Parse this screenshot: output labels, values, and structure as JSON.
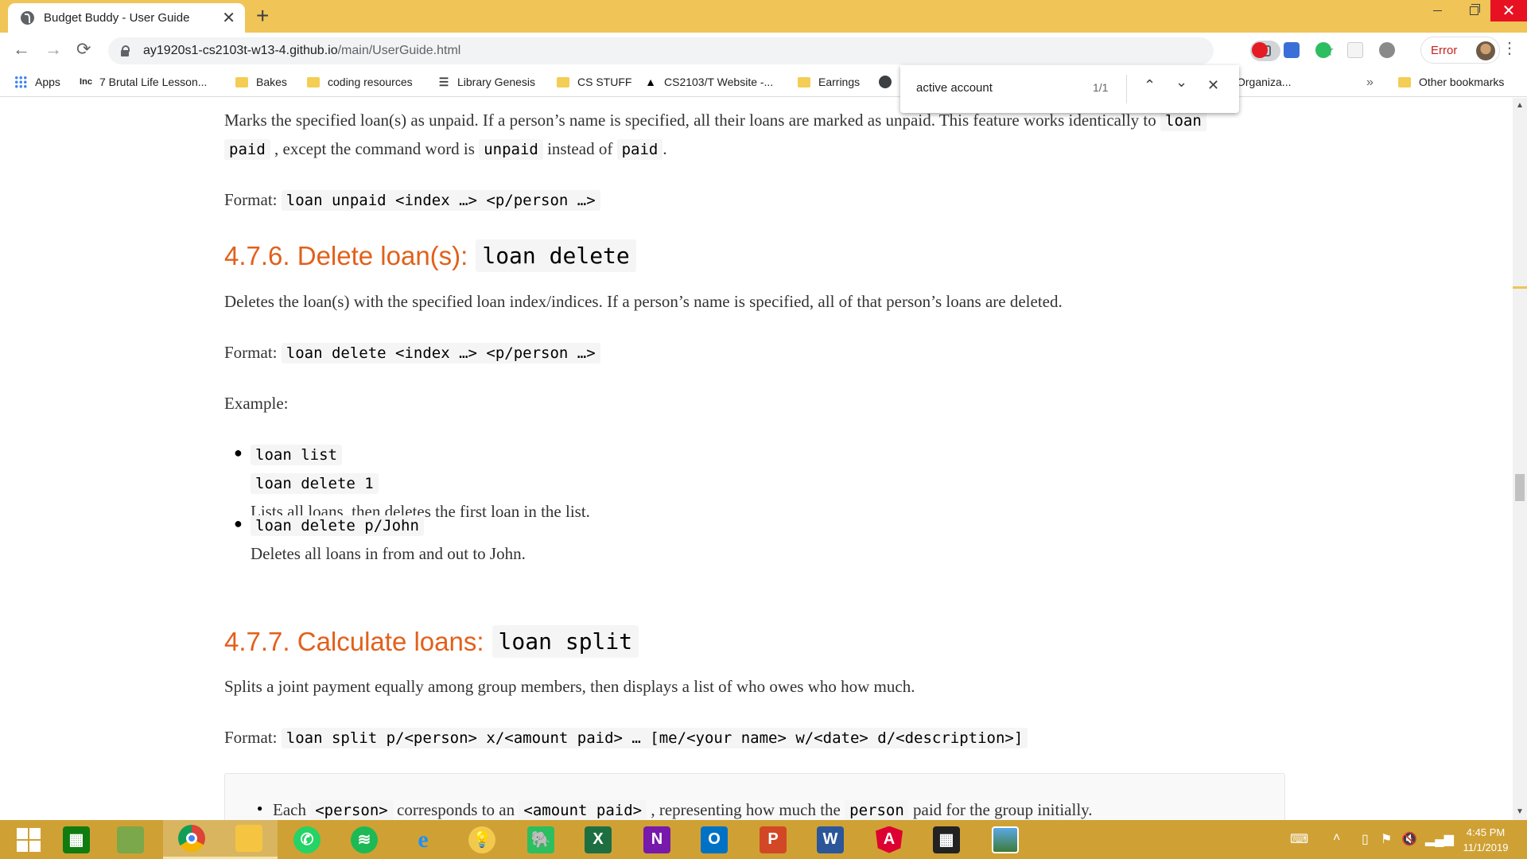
{
  "tab": {
    "title": "Budget Buddy - User Guide",
    "close": "✕",
    "new_tab": "+"
  },
  "window": {
    "minimize": "",
    "maximize": "",
    "close": "✕"
  },
  "toolbar": {
    "back": "←",
    "forward": "→",
    "reload": "⟳",
    "url_host": "ay1920s1-cs2103t-w13-4.github.io",
    "url_path": "/main/UserGuide.html",
    "zoom_icon": "⊕",
    "star_icon": "☆",
    "profile_label": "Error",
    "menu": "⋮"
  },
  "bookmarks": {
    "items": [
      {
        "label": "Apps",
        "icon": "apps-grid"
      },
      {
        "label": "7 Brutal Life Lesson...",
        "icon": "Inc"
      },
      {
        "label": "Bakes",
        "icon": "folder"
      },
      {
        "label": "coding resources",
        "icon": "folder"
      },
      {
        "label": "Library Genesis",
        "icon": "library"
      },
      {
        "label": "CS STUFF",
        "icon": "folder"
      },
      {
        "label": "CS2103/T Website -...",
        "icon": "graduation-cap"
      },
      {
        "label": "Earrings",
        "icon": "folder"
      },
      {
        "label": "Organiza...",
        "icon": "globe"
      }
    ],
    "more": "»",
    "other": "Other bookmarks"
  },
  "find": {
    "query": "active account",
    "count": "1/1",
    "prev": "⌃",
    "next": "⌄",
    "close": "✕"
  },
  "doc": {
    "p1_line1_a": "Marks the specified loan(s) as unpaid. If a person’s name is specified, all their loans are marked as unpaid. This feature works identically to",
    "p1_code1": "loan",
    "p1_code2": "paid",
    "p1_line2_b": ", except the command word is",
    "p1_code3": "unpaid",
    "p1_line2_c": "instead of",
    "p1_code4": "paid",
    "p1_line2_d": ".",
    "format_label": "Format:",
    "format_unpaid": "loan unpaid <index …> <p/person …>",
    "h_delete_text": "4.7.6. Delete loan(s):",
    "h_delete_code": "loan delete",
    "p_delete": "Deletes the loan(s) with the specified loan index/indices. If a person’s name is specified, all of that person’s loans are deleted.",
    "format_delete": "loan delete <index …> <p/person …>",
    "example_label": "Example:",
    "ex1_cmd1": "loan list",
    "ex1_cmd2": "loan delete 1",
    "ex1_desc": "Lists all loans, then deletes the first loan in the list.",
    "ex2_cmd": "loan delete p/John",
    "ex2_desc": "Deletes all loans in from and out to John.",
    "h_split_text": "4.7.7. Calculate loans:",
    "h_split_code": "loan split",
    "p_split": "Splits a joint payment equally among group members, then displays a list of who owes who how much.",
    "format_split": "loan split p/<person> x/<amount paid> … [me/<your name> w/<date> d/<description>]",
    "note_a": "Each",
    "note_code1": "<person>",
    "note_b": "corresponds to an",
    "note_code2": "<amount paid>",
    "note_c": ", representing how much the",
    "note_code3": "person",
    "note_d": "paid for the group initially."
  },
  "taskbar": {
    "clock_time": "4:45 PM",
    "clock_date": "11/1/2019"
  },
  "colors": {
    "tabbar": "#f0c457",
    "heading": "#e2601a",
    "taskbar": "#cfa134",
    "close": "#e81123"
  }
}
